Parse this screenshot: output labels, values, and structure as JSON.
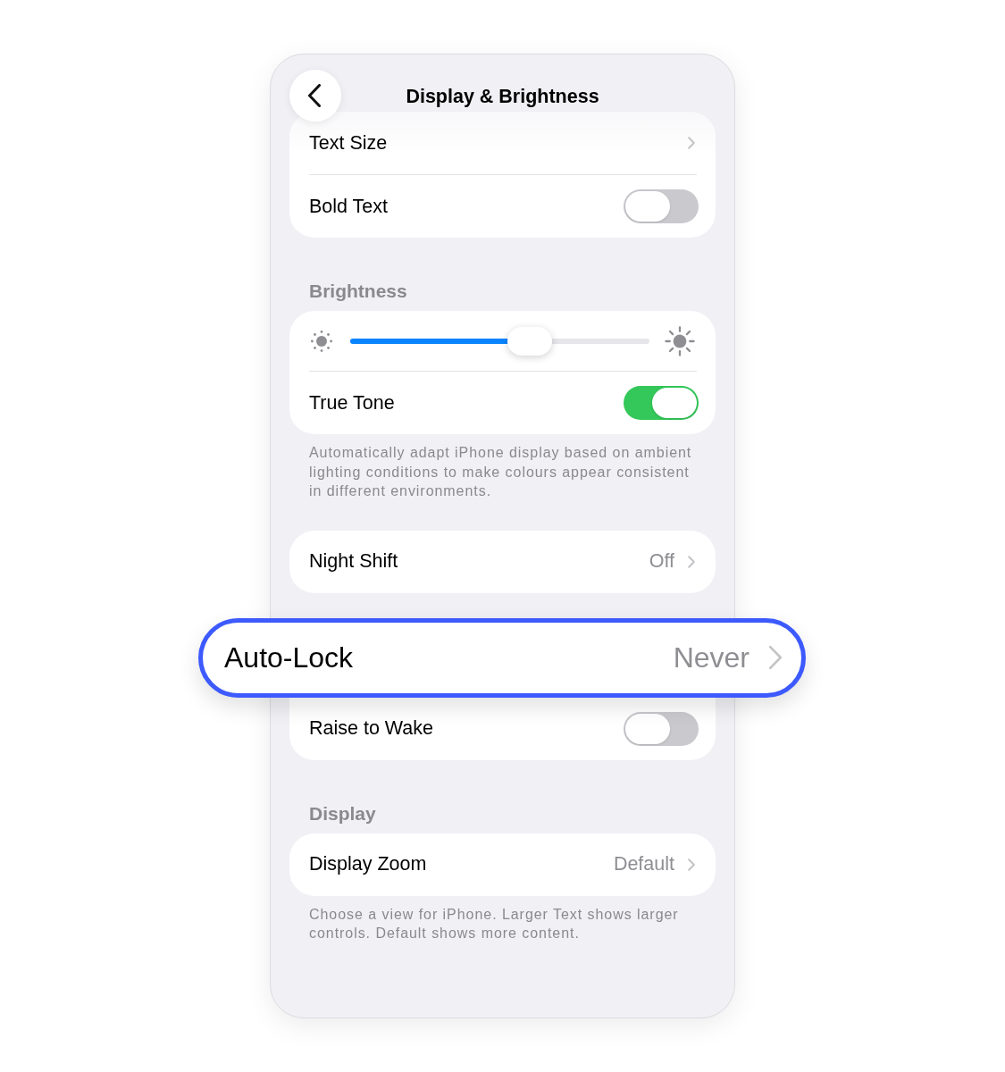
{
  "navigation": {
    "title": "Display & Brightness"
  },
  "sections": [
    {
      "rows": [
        {
          "kind": "link",
          "label": "Text Size",
          "highlighted": false
        },
        {
          "kind": "toggle",
          "label": "Bold Text",
          "on": false
        }
      ]
    },
    {
      "header": "Brightness",
      "rows": [
        {
          "kind": "slider",
          "level": 0.6
        },
        {
          "kind": "toggle",
          "label": "True Tone",
          "on": true
        }
      ],
      "footer": "Automatically adapt iPhone display based on ambient lighting conditions to make colours appear consistent in different environments."
    },
    {
      "rows": [
        {
          "kind": "link",
          "label": "Night Shift",
          "value": "Off",
          "highlighted": false
        }
      ]
    },
    {
      "rows": [
        {
          "kind": "link",
          "label": "Auto-Lock",
          "value": "Never",
          "highlighted": true
        },
        {
          "kind": "toggle",
          "label": "Raise to Wake",
          "on": false
        }
      ]
    },
    {
      "header": "Display",
      "rows": [
        {
          "kind": "link",
          "label": "Display Zoom",
          "value": "Default",
          "highlighted": false
        }
      ],
      "footer": "Choose a view for iPhone. Larger Text shows larger controls. Default shows more content."
    }
  ]
}
